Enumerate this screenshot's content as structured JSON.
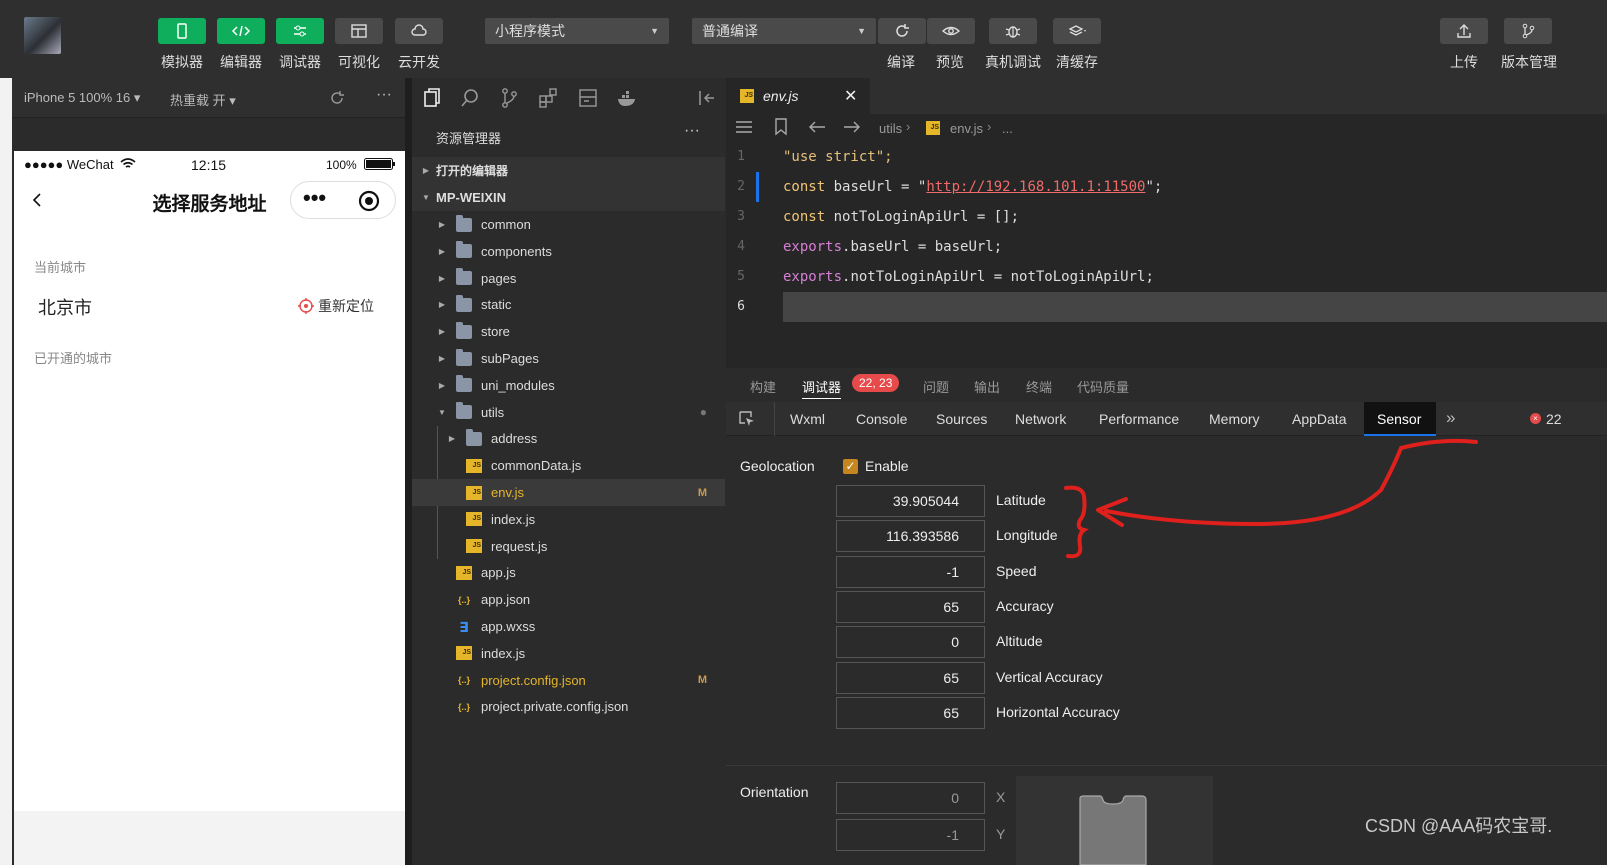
{
  "toolbar": {
    "left_edge_char": "开",
    "buttons": [
      {
        "label": "模拟器",
        "icon": "phone-icon"
      },
      {
        "label": "编辑器",
        "icon": "code-icon"
      },
      {
        "label": "调试器",
        "icon": "sliders-icon"
      },
      {
        "label": "可视化",
        "icon": "layout-icon"
      },
      {
        "label": "云开发",
        "icon": "cloud-icon"
      }
    ],
    "mode_select": "小程序模式",
    "compile_select": "普通编译",
    "actions": [
      {
        "label": "编译",
        "icon": "refresh-icon"
      },
      {
        "label": "预览",
        "icon": "eye-icon"
      },
      {
        "label": "真机调试",
        "icon": "bug-icon"
      },
      {
        "label": "清缓存",
        "icon": "layers-icon"
      }
    ],
    "right_actions": [
      {
        "label": "上传",
        "icon": "upload-icon"
      },
      {
        "label": "版本管理",
        "icon": "branch-icon"
      }
    ]
  },
  "simulator": {
    "device": "iPhone 5 100% 16",
    "hot_reload": "热重载 开",
    "status": {
      "carrier": "●●●●● WeChat",
      "time": "12:15",
      "battery": "100%"
    },
    "nav_title": "选择服务地址",
    "capsule_dots": "•••",
    "current_city_label": "当前城市",
    "current_city": "北京市",
    "relocate": "重新定位",
    "opened_cities_label": "已开通的城市"
  },
  "explorer": {
    "title": "资源管理器",
    "more": "···",
    "open_editors": "打开的编辑器",
    "project": "MP-WEIXIN",
    "tree": [
      {
        "name": "common",
        "type": "folder",
        "depth": 1,
        "arrow": "▶"
      },
      {
        "name": "components",
        "type": "folder",
        "depth": 1,
        "arrow": "▶"
      },
      {
        "name": "pages",
        "type": "folder",
        "depth": 1,
        "arrow": "▶"
      },
      {
        "name": "static",
        "type": "folder",
        "depth": 1,
        "arrow": "▶"
      },
      {
        "name": "store",
        "type": "folder",
        "depth": 1,
        "arrow": "▶"
      },
      {
        "name": "subPages",
        "type": "folder",
        "depth": 1,
        "arrow": "▶"
      },
      {
        "name": "uni_modules",
        "type": "folder",
        "depth": 1,
        "arrow": "▶"
      },
      {
        "name": "utils",
        "type": "folder",
        "depth": 1,
        "arrow": "▼",
        "badge": "●"
      },
      {
        "name": "address",
        "type": "folder",
        "depth": 2,
        "arrow": "▶"
      },
      {
        "name": "commonData.js",
        "type": "js",
        "depth": 2
      },
      {
        "name": "env.js",
        "type": "js",
        "depth": 2,
        "badge": "M",
        "selected": true
      },
      {
        "name": "index.js",
        "type": "js",
        "depth": 2
      },
      {
        "name": "request.js",
        "type": "js",
        "depth": 2
      },
      {
        "name": "app.js",
        "type": "js",
        "depth": 1
      },
      {
        "name": "app.json",
        "type": "json",
        "depth": 1
      },
      {
        "name": "app.wxss",
        "type": "css",
        "depth": 1
      },
      {
        "name": "index.js",
        "type": "js",
        "depth": 1
      },
      {
        "name": "project.config.json",
        "type": "json",
        "depth": 1,
        "badge": "M"
      },
      {
        "name": "project.private.config.json",
        "type": "json",
        "depth": 1
      }
    ]
  },
  "editor": {
    "tab": "env.js",
    "close": "✕",
    "breadcrumb": [
      "utils",
      "env.js",
      "..."
    ],
    "lines": [
      {
        "n": "1",
        "text": "\"use strict\";"
      },
      {
        "n": "2",
        "text": "const baseUrl = \"http://192.168.101.1:11500\";"
      },
      {
        "n": "3",
        "text": "const notToLoginApiUrl = [];"
      },
      {
        "n": "4",
        "text": "exports.baseUrl = baseUrl;"
      },
      {
        "n": "5",
        "text": "exports.notToLoginApiUrl = notToLoginApiUrl;"
      },
      {
        "n": "6",
        "text": ""
      }
    ]
  },
  "panel": {
    "top_tabs": [
      "构建",
      "调试器",
      "问题",
      "输出",
      "终端",
      "代码质量"
    ],
    "debugger_badge": "22, 23",
    "dev_tabs": [
      "Wxml",
      "Console",
      "Sources",
      "Network",
      "Performance",
      "Memory",
      "AppData",
      "Sensor"
    ],
    "more": "»",
    "error_count": "22",
    "geolocation_label": "Geolocation",
    "enable_label": "Enable",
    "enabled": true,
    "fields": [
      {
        "label": "Latitude",
        "value": "39.905044"
      },
      {
        "label": "Longitude",
        "value": "116.393586"
      },
      {
        "label": "Speed",
        "value": "-1"
      },
      {
        "label": "Accuracy",
        "value": "65"
      },
      {
        "label": "Altitude",
        "value": "0"
      },
      {
        "label": "Vertical Accuracy",
        "value": "65"
      },
      {
        "label": "Horizontal Accuracy",
        "value": "65"
      }
    ],
    "orientation_label": "Orientation",
    "orientation": [
      {
        "axis": "X",
        "value": "0"
      },
      {
        "axis": "Y",
        "value": "-1"
      }
    ]
  },
  "watermark": "CSDN @AAA码农宝哥.",
  "colors": {
    "accent_green": "#0fae5d",
    "annotation_red": "#e0201c",
    "badge_red": "#e64a4a",
    "active_tab_blue": "#1a73e8"
  }
}
